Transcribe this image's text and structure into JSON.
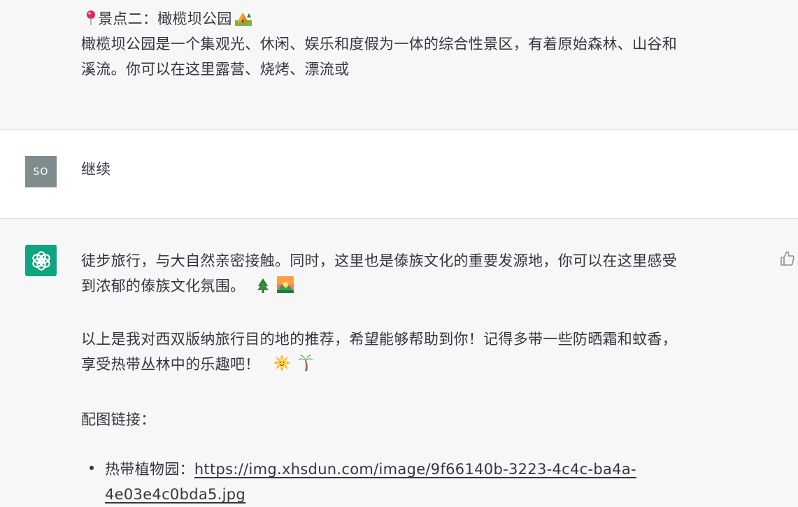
{
  "assistant_top": {
    "heading_prefix": "景点二：橄榄坝公园",
    "heading_emoji": "🏕",
    "pin_icon": "pin-icon",
    "line1": "橄榄坝公园是一个集观光、休闲、娱乐和度假为一体的综合性景区，有着原始森林、山谷和",
    "line2": "溪流。你可以在这里露营、烧烤、漂流或"
  },
  "user_message": {
    "avatar": "SO",
    "text": "继续"
  },
  "assistant_main": {
    "para1_line1": "徒步旅行，与大自然亲密接触。同时，这里也是傣族文化的重要发源地，你可以在这里感受",
    "para1_line2": "到浓郁的傣族文化氛围。",
    "para2_line1": "以上是我对西双版纳旅行目的地的推荐，希望能够帮助到你！记得多带一些防晒霜和蚊香，",
    "para2_line2": "享受热带丛林中的乐趣吧！",
    "para3": "配图链接：",
    "list": [
      {
        "label": "热带植物园：",
        "url_line1": "https://img.xhsdun.com/image/9f66140b-3223-4c4c-ba4a-",
        "url_line2": "4e03e4c0bda5.jpg"
      }
    ]
  },
  "icons": {
    "avatar_bot": "openai-logo-icon",
    "thumb": "thumbs-up-icon",
    "emoji_tree": "evergreen-tree-icon",
    "emoji_sunrise": "sunrise-mountains-icon",
    "emoji_sun": "sun-with-face-icon",
    "emoji_palm": "palm-tree-icon"
  },
  "colors": {
    "assistant_bg": "#f7f7f8",
    "user_bg": "#ffffff",
    "bot_avatar": "#10a37f",
    "user_avatar": "#7f8c8d",
    "text": "#343541"
  }
}
